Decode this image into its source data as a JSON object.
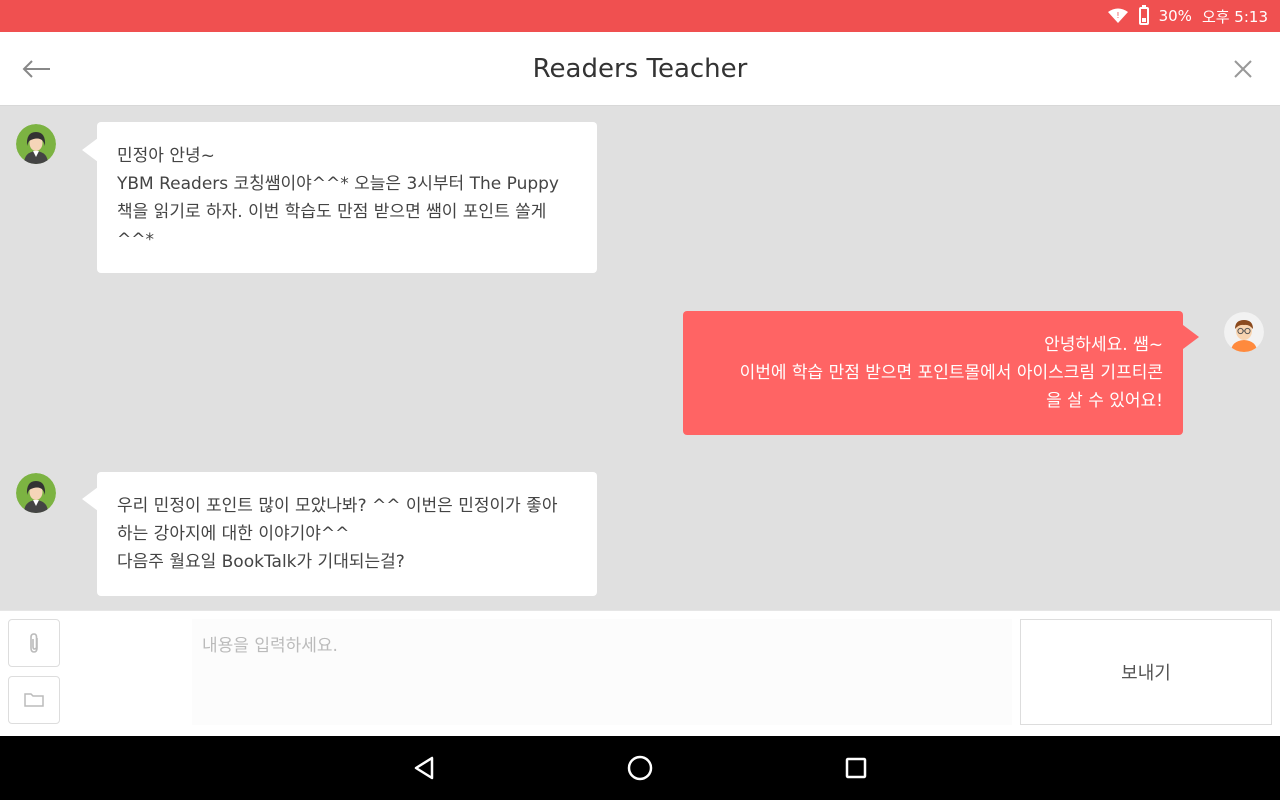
{
  "status_bar": {
    "battery": "30%",
    "time": "오후 5:13"
  },
  "header": {
    "title": "Readers Teacher",
    "back_icon": "back-arrow-icon",
    "close_icon": "close-icon"
  },
  "messages": [
    {
      "sender": "teacher",
      "lines": [
        "민정아 안녕~",
        "YBM Readers 코칭쌤이야^^* 오늘은 3시부터 The Puppy",
        "책을 읽기로 하자. 이번 학습도 만점 받으면 쌤이 포인트 쏠게",
        "^^*"
      ]
    },
    {
      "sender": "student",
      "lines": [
        "안녕하세요. 쌤~",
        "이번에 학습 만점 받으면 포인트몰에서 아이스크림 기프티콘",
        "을 살 수 있어요!"
      ]
    },
    {
      "sender": "teacher",
      "lines": [
        "우리 민정이 포인트 많이 모았나봐? ^^ 이번은 민정이가 좋아",
        "하는 강아지에 대한 이야기야^^",
        "다음주 월요일 BookTalk가 기대되는걸?"
      ]
    }
  ],
  "input": {
    "placeholder": "내용을 입력하세요.",
    "value": "",
    "send_label": "보내기",
    "attach_icon": "paperclip-icon",
    "folder_icon": "folder-icon"
  },
  "colors": {
    "status_bar": "#f05050",
    "student_bubble": "#ff6464",
    "chat_background": "#e0e0e0"
  }
}
